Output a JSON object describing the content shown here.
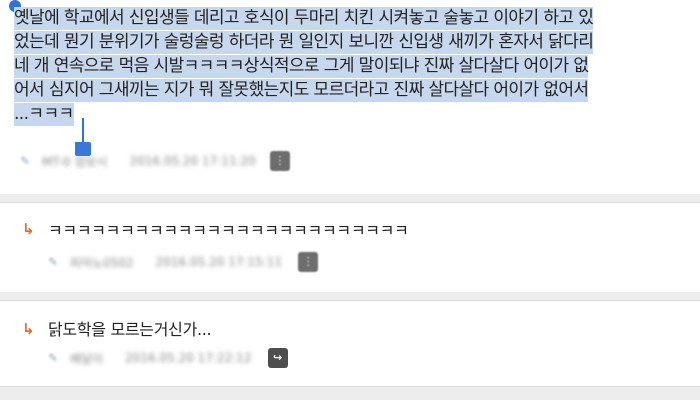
{
  "post": {
    "lines": [
      "옛날에 학교에서 신입생들 데리고 호식이 두마리 치킨 시켜놓고 술놓고 이야기 하고 있",
      "었는데 뭔기 분위기가 술렁술렁 하더라 뭔 일인지 보니깐 신입생 새끼가 혼자서 닭다리",
      "네 개 연속으로 먹음 시발ㅋㅋㅋㅋ상식적으로 그게 말이되냐 진짜 살다살다 어이가 없",
      "어서 심지어 그새끼는 지가 뭐 잘못했는지도 모르더라고 진짜 살다살다 어이가 없어서",
      "...ㅋㅋㅋ"
    ],
    "author": "MT-0 정보시",
    "time": "2016.05.20 17:11:20"
  },
  "comments": [
    {
      "text": "ㅋㅋㅋㅋㅋㅋㅋㅋㅋㅋㅋㅋㅋㅋㅋㅋㅋㅋㅋㅋㅋㅋㅋㅋㅋ",
      "author": "피아노0502",
      "time": "2016.05.20 17:15:11"
    },
    {
      "text": "닭도학을 모르는거신가...",
      "author": "배달이",
      "time": "2016.05.20 17:22:12"
    }
  ],
  "icons": {
    "reply": "reply-arrow-icon",
    "user": "user-icon",
    "action": "more-icon",
    "share": "reply-share-icon"
  },
  "colors": {
    "selection": "#c6d7ee",
    "handle": "#2f72d6",
    "reply_arrow": "#e0702d"
  }
}
